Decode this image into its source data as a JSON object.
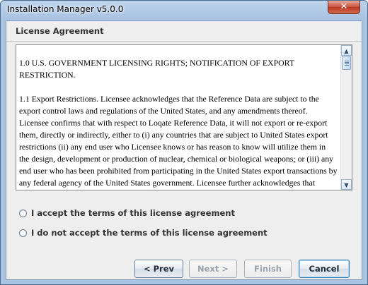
{
  "window": {
    "title": "Installation Manager v5.0.0",
    "close_glyph": "✕"
  },
  "page": {
    "section_title": "License Agreement"
  },
  "license": {
    "paragraphs": [
      "1.0 U.S. GOVERNMENT LICENSING RIGHTS; NOTIFICATION OF EXPORT RESTRICTION.",
      "1.1 Export Restrictions. Licensee acknowledges that the Reference Data are subject to the export control laws and regulations of the United States, and any amendments thereof. Licensee confirms that with respect to Loqate Reference Data, it will not export or re-export them, directly or indirectly, either to (i) any countries that are subject to United States export restrictions (ii) any end user who Licensee knows or has reason to know will utilize them in the design, development or production of nuclear, chemical or biological weapons; or (iii) any end user who has been prohibited from participating in the United States export transactions by any federal agency of the United States government. Licensee further acknowledges that"
    ]
  },
  "scrollbar": {
    "up_glyph": "▲",
    "down_glyph": "▼"
  },
  "options": {
    "accept_label": "I accept the terms of this license agreement",
    "decline_label": "I do not accept the terms of this license agreement"
  },
  "buttons": {
    "prev_label": "< Prev",
    "next_label": "Next >",
    "finish_label": "Finish",
    "cancel_label": "Cancel"
  }
}
